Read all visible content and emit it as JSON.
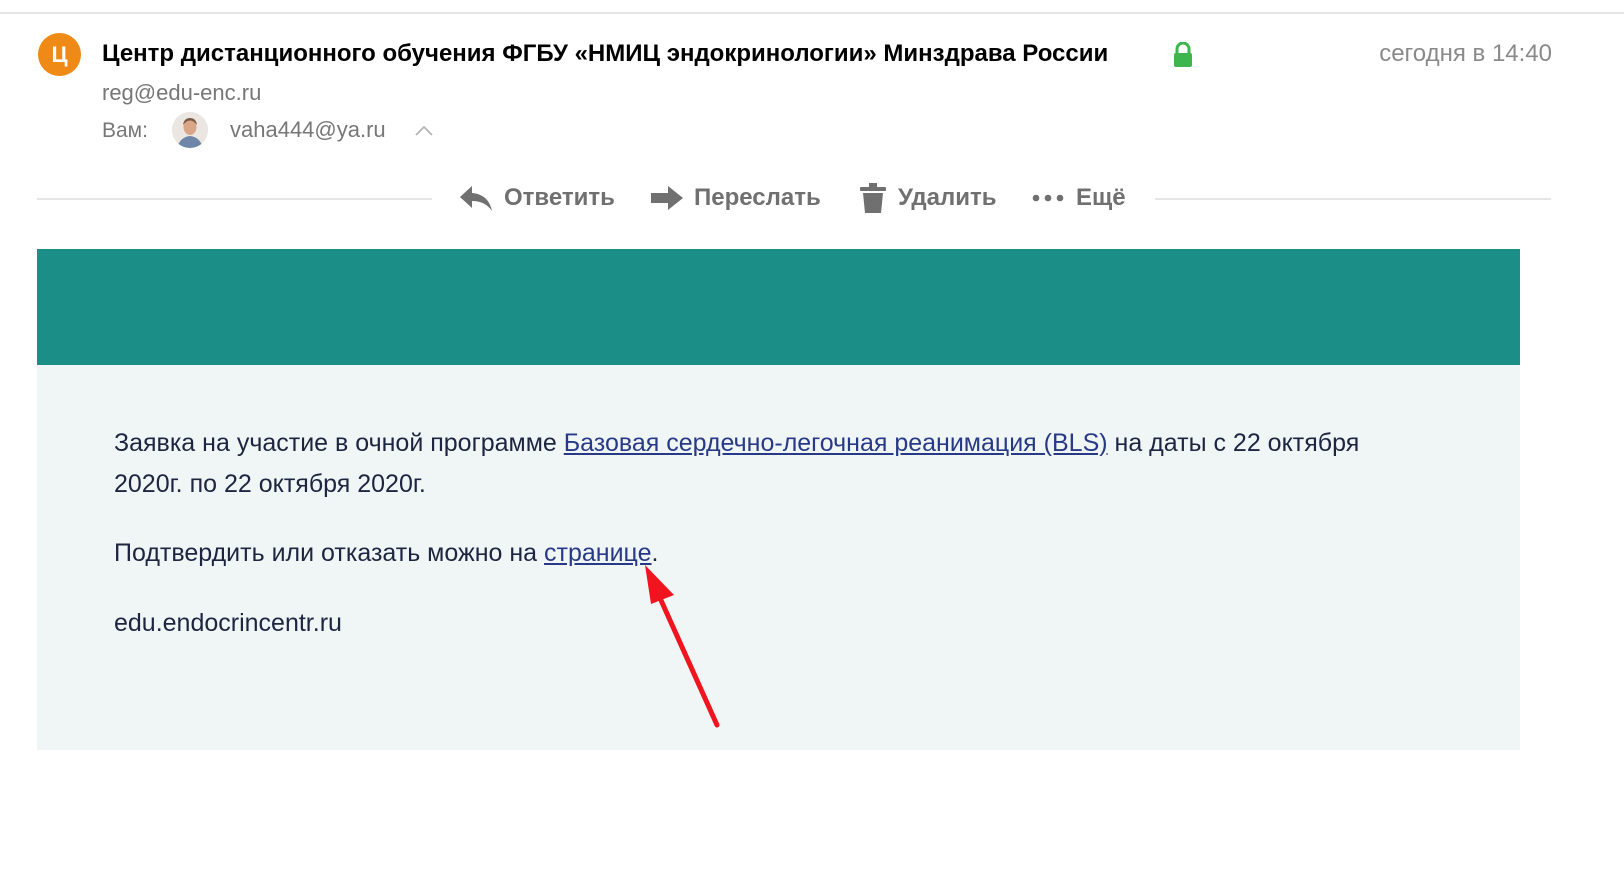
{
  "header": {
    "avatar_letter": "Ц",
    "sender_name": "Центр дистанционного обучения ФГБУ «НМИЦ эндокринологии» Минздрава России",
    "date": "сегодня в 14:40",
    "sender_email": "reg@edu-enc.ru",
    "to_label": "Вам:",
    "recipient_email": "vaha444@ya.ru"
  },
  "toolbar": {
    "reply": "Ответить",
    "forward": "Переслать",
    "delete": "Удалить",
    "more": "Ещё"
  },
  "body": {
    "line1_start": "Заявка на участие в очной программе ",
    "program_link": "Базовая сердечно-легочная реанимация (BLS)",
    "line1_end": " на даты с 22 октября 2020г. по 22 октября 2020г.",
    "line2_start": "Подтвердить или отказать можно на ",
    "page_link": "странице",
    "line2_end": ".",
    "site": "edu.endocrincentr.ru"
  },
  "colors": {
    "avatar": "#ef8a17",
    "banner": "#1b8f87",
    "content_bg": "#f0f6f5",
    "link": "#283a87",
    "lock": "#3fb54d",
    "arrow": "#f0141e"
  },
  "icons": [
    "lock-icon",
    "chevron-up-icon",
    "reply-icon",
    "forward-icon",
    "trash-icon",
    "more-dots-icon"
  ]
}
